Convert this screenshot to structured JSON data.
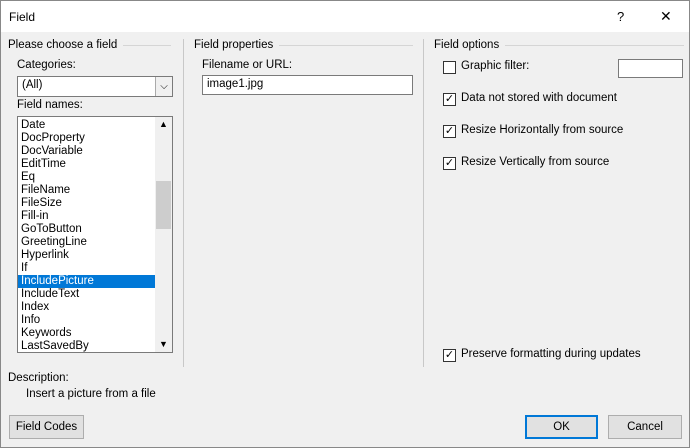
{
  "window": {
    "title": "Field",
    "help": "?",
    "close": "✕"
  },
  "choose": {
    "heading": "Please choose a field",
    "categories_label": "Categories:",
    "categories_value": "(All)",
    "field_names_label": "Field names:",
    "field_names": [
      "Date",
      "DocProperty",
      "DocVariable",
      "EditTime",
      "Eq",
      "FileName",
      "FileSize",
      "Fill-in",
      "GoToButton",
      "GreetingLine",
      "Hyperlink",
      "If",
      "IncludePicture",
      "IncludeText",
      "Index",
      "Info",
      "Keywords",
      "LastSavedBy"
    ],
    "selected": "IncludePicture"
  },
  "properties": {
    "heading": "Field properties",
    "filename_label": "Filename or URL:",
    "filename_value": "image1.jpg"
  },
  "options": {
    "heading": "Field options",
    "graphic_filter": {
      "label": "Graphic filter:",
      "checked": false,
      "value": ""
    },
    "data_not_stored": {
      "label": "Data not stored with document",
      "checked": true
    },
    "resize_h": {
      "label": "Resize Horizontally from source",
      "checked": true
    },
    "resize_v": {
      "label": "Resize Vertically from source",
      "checked": true
    },
    "preserve": {
      "label": "Preserve formatting during updates",
      "checked": true
    }
  },
  "description": {
    "label": "Description:",
    "text": "Insert a picture from a file"
  },
  "buttons": {
    "field_codes": "Field Codes",
    "ok": "OK",
    "cancel": "Cancel"
  },
  "check_glyph": "✓"
}
